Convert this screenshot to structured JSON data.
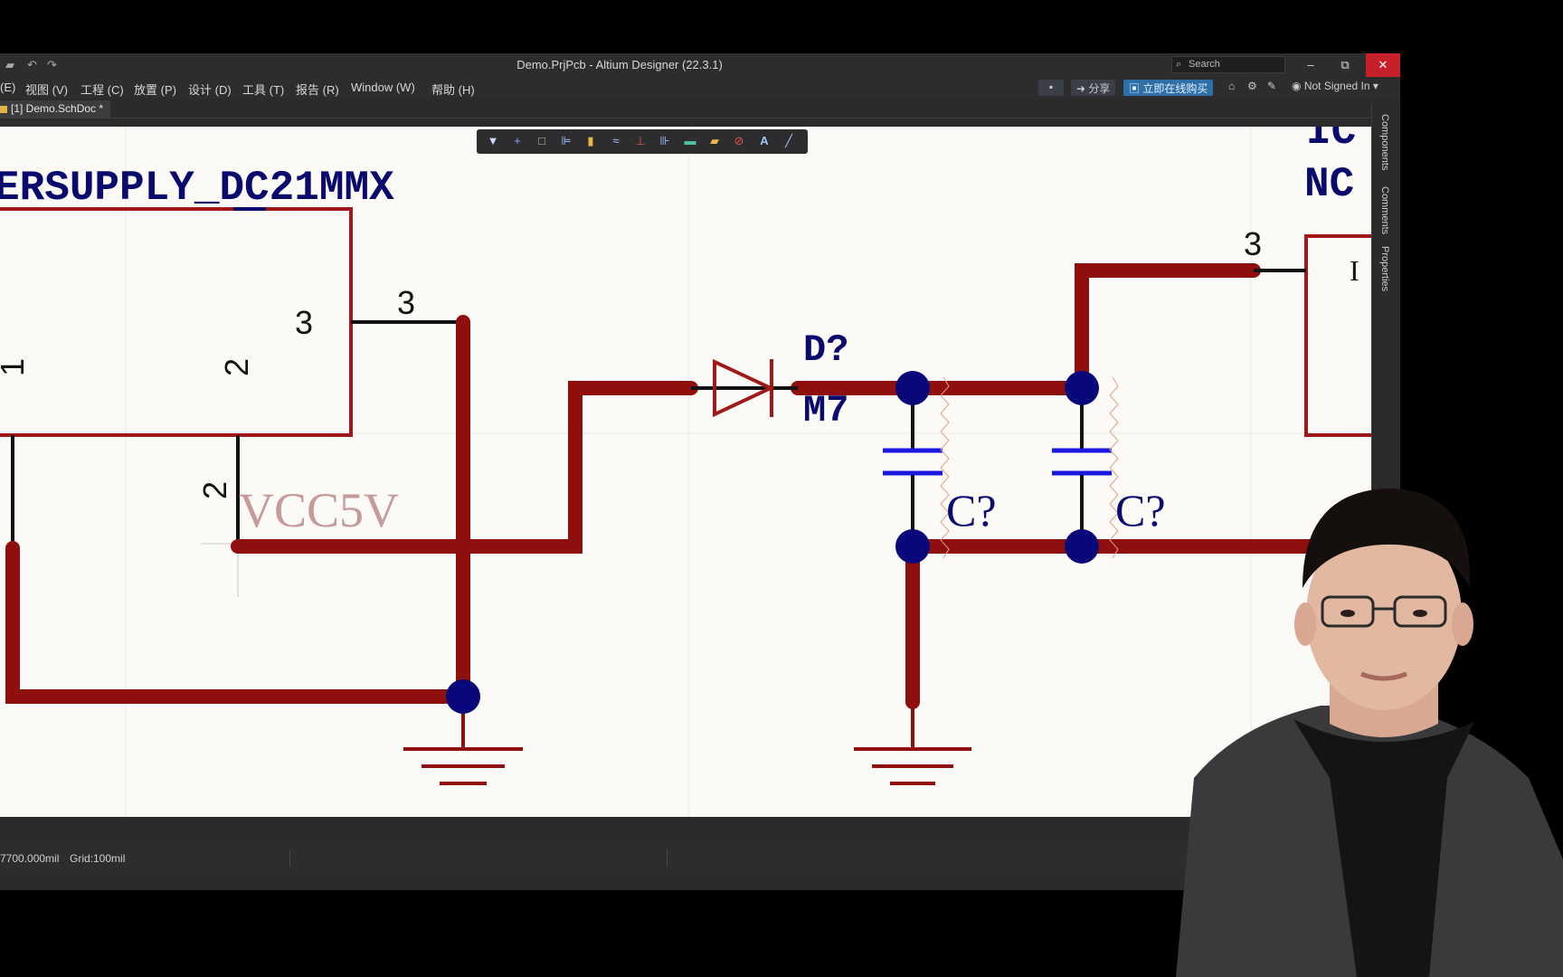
{
  "titlebar": {
    "title": "Demo.PrjPcb - Altium Designer (22.3.1)",
    "search_placeholder": "Search",
    "minimize": "–",
    "restore": "⧉",
    "close": "✕"
  },
  "menu": {
    "items": [
      "(E)",
      "视图 (V)",
      "工程 (C)",
      "放置 (P)",
      "设计 (D)",
      "工具 (T)",
      "报告 (R)",
      "Window (W)",
      "帮助 (H)"
    ],
    "share": "分享",
    "buy_online": "立即在线购买",
    "account": "Not Signed In"
  },
  "tabs": {
    "active_doc": "[1] Demo.SchDoc *"
  },
  "side_panels": [
    "Components",
    "Comments",
    "Properties"
  ],
  "schematic": {
    "component_title": "ERSUPPLY_DC21MMX",
    "right_component_line1": "IC",
    "right_component_line2": "NC",
    "pin_3_inner": "3",
    "pin_3_outer": "3",
    "pin_2_inner": "2",
    "pin_2_outer": "2",
    "pin_1_inner": "1",
    "right_pin_3": "3",
    "net_label": "VCC5V",
    "diode_designator": "D?",
    "diode_value": "M7",
    "cap1_designator": "C?",
    "cap2_designator": "C?",
    "cursor": "I"
  },
  "status": {
    "coords": "7700.000mil",
    "grid": "Grid:100mil"
  },
  "colors": {
    "wire": "#8f0f0f",
    "junction": "#08087a",
    "component_outline": "#a01818",
    "designator": "#0a0a6e",
    "net_label": "#c59a9a",
    "canvas": "#fbfaf6",
    "capacitor": "#1818e0"
  },
  "icons": {
    "toolbar": [
      "filter-icon",
      "add-icon",
      "select-rect-icon",
      "align-icon",
      "part-icon",
      "wire-icon",
      "power-port-icon",
      "bus-icon",
      "sheet-icon",
      "port-icon",
      "no-erc-icon",
      "text-icon",
      "line-icon"
    ],
    "taskbar": [
      "chrome-icon",
      "explorer-icon",
      "wps-icon",
      "altium-icon",
      "app-icon",
      "pdf-icon"
    ]
  }
}
